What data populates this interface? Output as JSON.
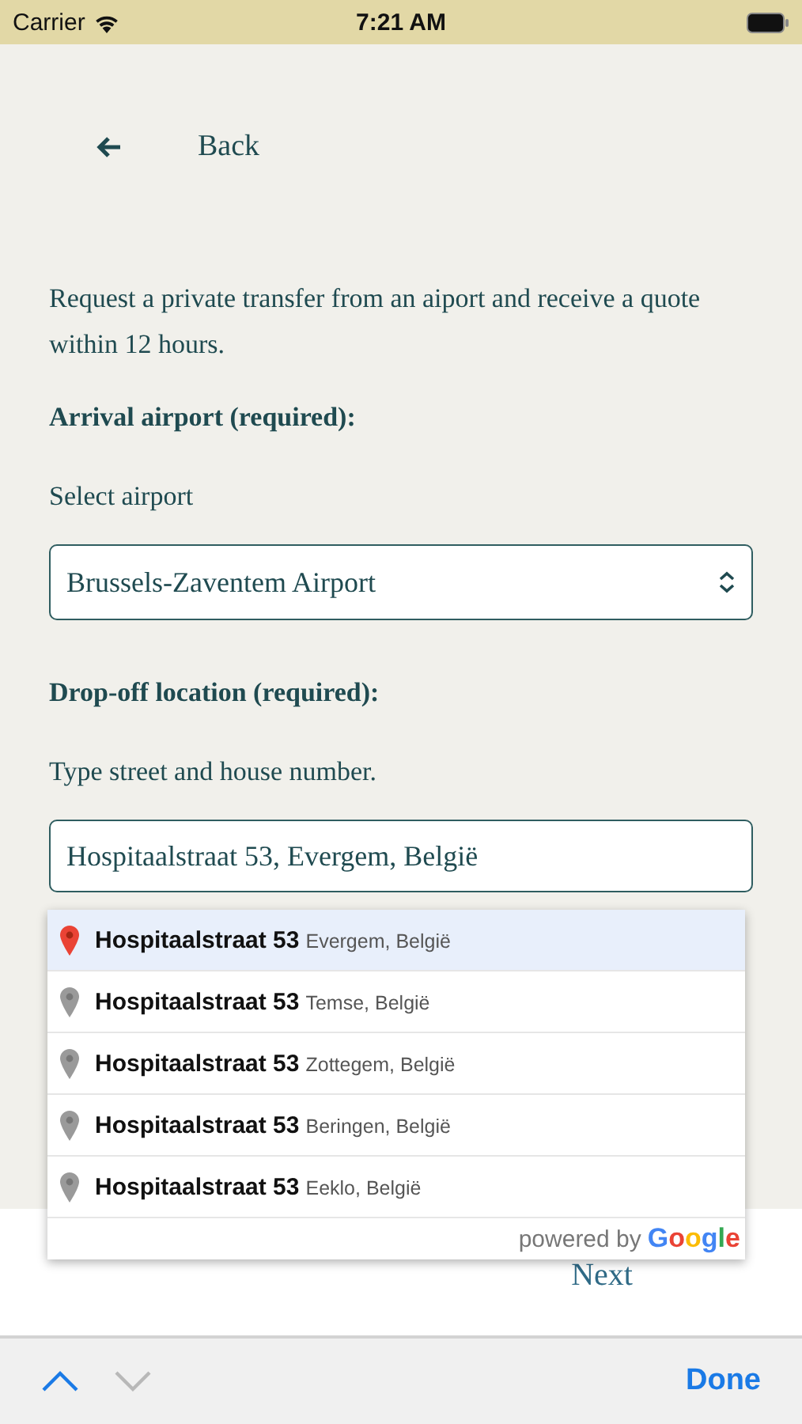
{
  "status_bar": {
    "carrier": "Carrier",
    "time": "7:21 AM"
  },
  "back": {
    "label": "Back"
  },
  "intro": "Request a private transfer from an aiport and receive a quote within 12 hours.",
  "arrival": {
    "label": "Arrival airport (required):",
    "hint": "Select airport",
    "value": "Brussels-Zaventem Airport"
  },
  "dropoff": {
    "label": "Drop-off location (required):",
    "hint": "Type street and house number.",
    "value": "Hospitaalstraat 53, Evergem, België"
  },
  "suggestions": [
    {
      "main": "Hospitaalstraat 53",
      "secondary": "Evergem, België",
      "selected": true
    },
    {
      "main": "Hospitaalstraat 53",
      "secondary": "Temse, België",
      "selected": false
    },
    {
      "main": "Hospitaalstraat 53",
      "secondary": "Zottegem, België",
      "selected": false
    },
    {
      "main": "Hospitaalstraat 53",
      "secondary": "Beringen, België",
      "selected": false
    },
    {
      "main": "Hospitaalstraat 53",
      "secondary": "Eeklo, België",
      "selected": false
    }
  ],
  "attribution": {
    "text": "powered by",
    "brand": "Google"
  },
  "next": "Next",
  "keyboard_bar": {
    "previous_disabled": false,
    "next_disabled": true,
    "done": "Done"
  }
}
